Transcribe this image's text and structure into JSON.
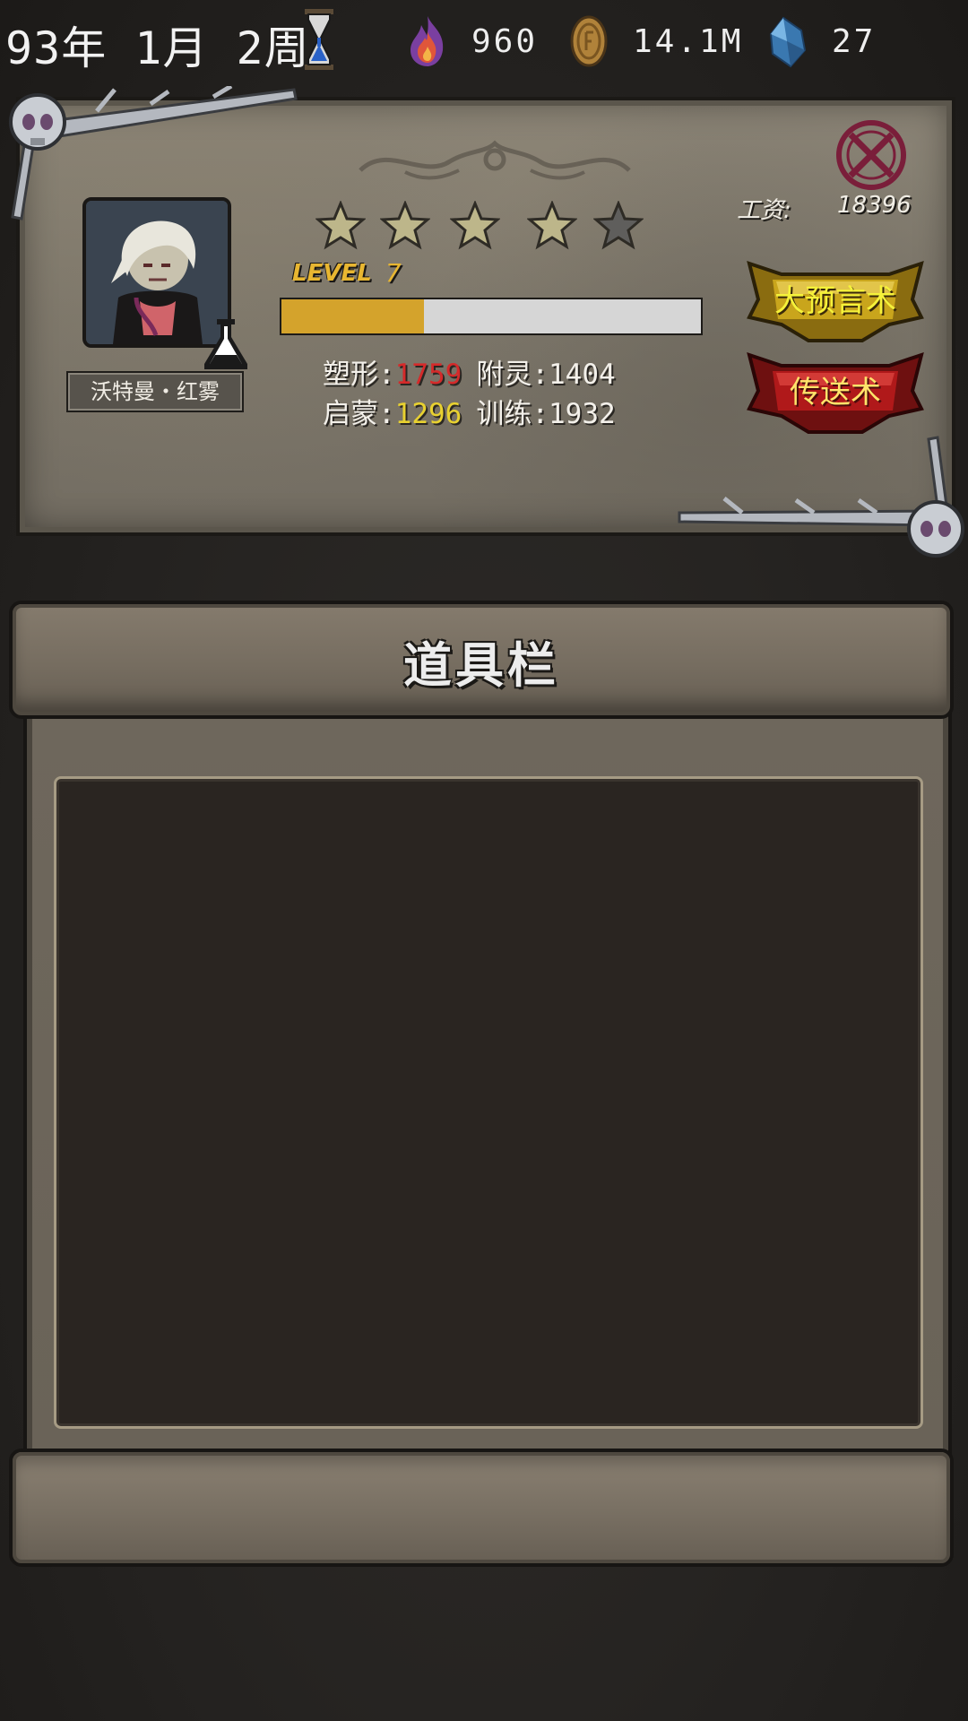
{
  "topbar": {
    "date": "93年 1月 2周",
    "resources": [
      {
        "icon": "flame-icon",
        "value": "960"
      },
      {
        "icon": "coin-icon",
        "value": "14.1M"
      },
      {
        "icon": "crystal-icon",
        "value": "27"
      }
    ]
  },
  "character": {
    "name": "沃特曼・红雾",
    "stars_filled": 4,
    "stars_total": 5,
    "level_label": "LEVEL",
    "level": "7",
    "xp_fraction": 0.34,
    "wage_label": "工资:",
    "wage": "18396",
    "stats": {
      "row1": [
        {
          "label": "塑形:",
          "value": "1759",
          "color": "#d52a2a"
        },
        {
          "label": "附灵:",
          "value": "1404"
        }
      ],
      "row2": [
        {
          "label": "启蒙:",
          "value": "1296",
          "color": "#e8d130"
        },
        {
          "label": "训练:",
          "value": "1932"
        }
      ]
    },
    "buttons": {
      "prophecy": "大预言术",
      "teleport": "传送术"
    }
  },
  "inventory": {
    "title": "道具栏"
  },
  "colors": {
    "xp_fill": "#d4a32c",
    "gold_button": "#c9a51c",
    "red_button": "#b0191a"
  }
}
